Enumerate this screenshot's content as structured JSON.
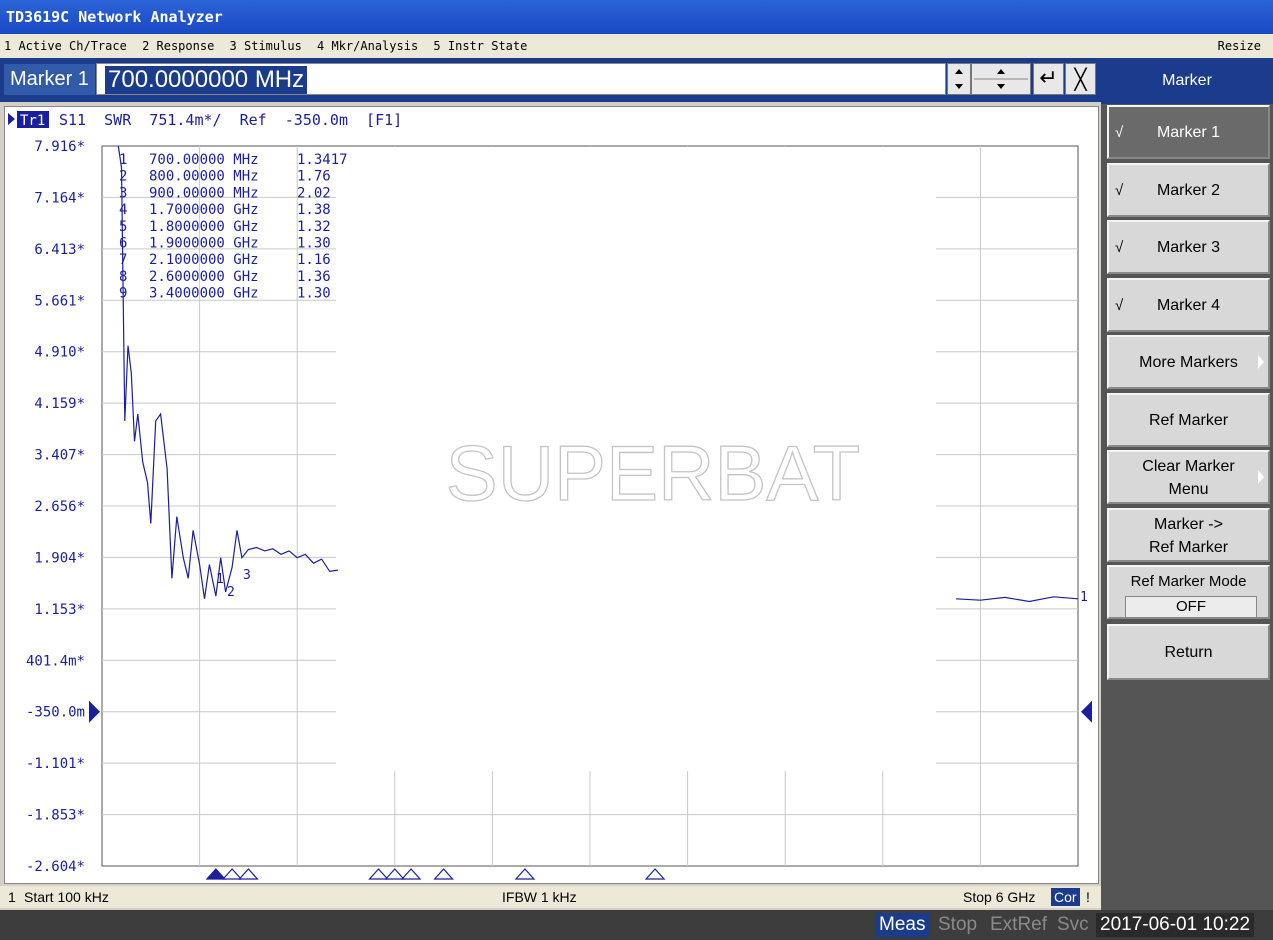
{
  "window": {
    "title": "TD3619C Network Analyzer"
  },
  "menu": {
    "items": [
      "1 Active Ch/Trace",
      "2 Response",
      "3 Stimulus",
      "4 Mkr/Analysis",
      "5 Instr State"
    ],
    "resize": "Resize"
  },
  "entry": {
    "label": "Marker 1",
    "value": "700.0000000 MHz",
    "enter_glyph": "↵",
    "close_glyph": "╳"
  },
  "trace": {
    "header": "S11  SWR  751.4m*/  Ref  -350.0m  [F1]",
    "tag": "Tr1"
  },
  "chart_data": {
    "type": "line",
    "title": "",
    "xlabel": "",
    "ylabel": "",
    "x_range_hz": [
      100000,
      6000000000
    ],
    "ylim": [
      -2.604,
      7.916
    ],
    "ytick_labels": [
      "7.916*",
      "7.164*",
      "6.413*",
      "5.661*",
      "4.910*",
      "4.159*",
      "3.407*",
      "2.656*",
      "1.904*",
      "1.153*",
      "401.4m*",
      "-350.0m",
      "-1.101*",
      "-1.853*",
      "-2.604*"
    ],
    "reference_value": -0.35,
    "grid": true,
    "series": [
      {
        "x_ghz": [
          0.1,
          0.12,
          0.14,
          0.16,
          0.18,
          0.2,
          0.22,
          0.25,
          0.28,
          0.3,
          0.33,
          0.36,
          0.4,
          0.43,
          0.46,
          0.5,
          0.53,
          0.56,
          0.6,
          0.63,
          0.66,
          0.7,
          0.73,
          0.76,
          0.8,
          0.83,
          0.86,
          0.9,
          0.95,
          1.0,
          1.05,
          1.1,
          1.15,
          1.2,
          1.25,
          1.3,
          1.35,
          1.4,
          1.45
        ],
        "y": [
          8.3,
          7.6,
          3.9,
          5.0,
          4.6,
          3.6,
          4.0,
          3.3,
          3.0,
          2.4,
          3.9,
          4.0,
          3.2,
          1.6,
          2.5,
          1.9,
          1.6,
          2.3,
          1.8,
          1.3,
          1.8,
          1.34,
          1.9,
          1.4,
          1.76,
          2.3,
          1.9,
          2.02,
          2.05,
          2.0,
          2.03,
          1.95,
          2.0,
          1.9,
          1.95,
          1.82,
          1.88,
          1.7,
          1.72
        ]
      },
      {
        "x_ghz": [
          5.25,
          5.4,
          5.55,
          5.7,
          5.85,
          6.0
        ],
        "y": [
          1.3,
          1.28,
          1.32,
          1.26,
          1.33,
          1.3
        ]
      }
    ],
    "markers": [
      {
        "n": "1",
        "stim": "700.00000 MHz",
        "val": "1.3417"
      },
      {
        "n": "2",
        "stim": "800.00000 MHz",
        "val": "1.76"
      },
      {
        "n": "3",
        "stim": "900.00000 MHz",
        "val": "2.02"
      },
      {
        "n": "4",
        "stim": "1.7000000 GHz",
        "val": "1.38"
      },
      {
        "n": "5",
        "stim": "1.8000000 GHz",
        "val": "1.32"
      },
      {
        "n": "6",
        "stim": "1.9000000 GHz",
        "val": "1.30"
      },
      {
        "n": "7",
        "stim": "2.1000000 GHz",
        "val": "1.16"
      },
      {
        "n": "8",
        "stim": "2.6000000 GHz",
        "val": "1.36"
      },
      {
        "n": "9",
        "stim": "3.4000000 GHz",
        "val": "1.30"
      }
    ],
    "marker_label_1": "1",
    "marker_label_2": "2",
    "marker_label_3": "3",
    "end_label": "1",
    "watermark": "SUPERBAT"
  },
  "status": {
    "channel": "1",
    "start": "Start 100 kHz",
    "ifbw": "IFBW 1 kHz",
    "stop": "Stop 6 GHz",
    "cor": "Cor",
    "excl": "!"
  },
  "footer": {
    "meas": "Meas",
    "stop": "Stop",
    "extref": "ExtRef",
    "svc": "Svc",
    "datetime": "2017-06-01 10:22"
  },
  "panel": {
    "title": "Marker",
    "check": "√",
    "keys": {
      "marker1": "Marker 1",
      "marker2": "Marker 2",
      "marker3": "Marker 3",
      "marker4": "Marker 4",
      "more": "More Markers",
      "ref": "Ref Marker",
      "clear_1": "Clear Marker",
      "clear_2": "Menu",
      "toref_1": "Marker ->",
      "toref_2": "Ref Marker",
      "mode": "Ref Marker Mode",
      "mode_value": "OFF",
      "return": "Return"
    }
  },
  "colors": {
    "trace": "#1b1f9e",
    "accent": "#1b3c8c",
    "grid": "#c8c8c8"
  }
}
